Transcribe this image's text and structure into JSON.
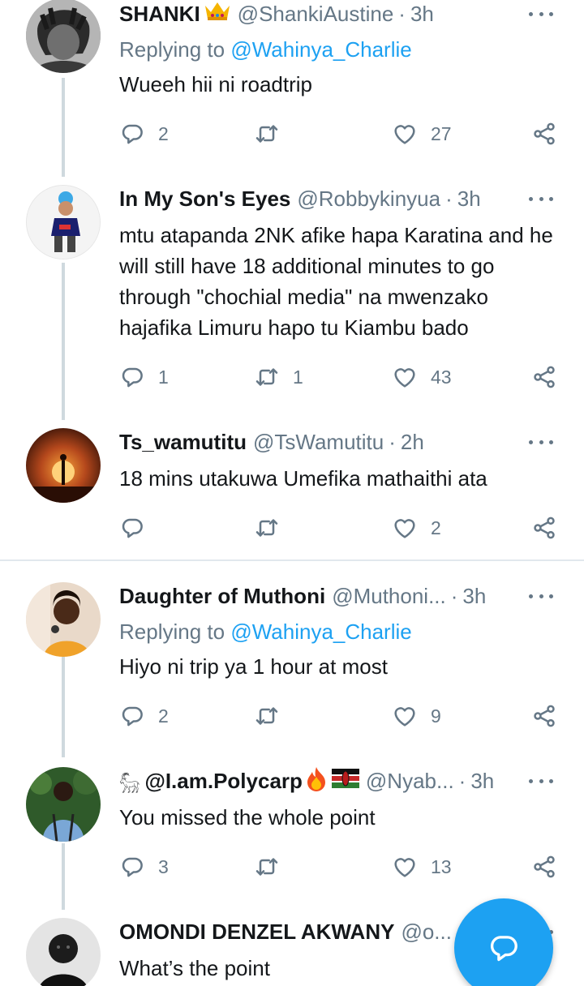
{
  "tweets": [
    {
      "name": "SHANKI",
      "handle": "@ShankiAustine",
      "time": "3h",
      "replying_label": "Replying to",
      "replying_to": "@Wahinya_Charlie",
      "text": "Wueeh hii ni roadtrip",
      "replies": "2",
      "retweets": "",
      "likes": "27"
    },
    {
      "name": "In My Son's Eyes",
      "handle": "@Robbykinyua",
      "time": "3h",
      "text": "mtu atapanda 2NK afike hapa Karatina and he will still have 18 additional minutes to go through \"chochial media\" na mwenzako hajafika Limuru hapo tu Kiambu bado",
      "replies": "1",
      "retweets": "1",
      "likes": "43"
    },
    {
      "name": "Ts_wamutitu",
      "handle": "@TsWamutitu",
      "time": "2h",
      "text": "18 mins utakuwa Umefika mathaithi ata",
      "replies": "",
      "retweets": "",
      "likes": "2"
    },
    {
      "name": "Daughter of Muthoni",
      "handle": "@Muthoni...",
      "time": "3h",
      "replying_label": "Replying to",
      "replying_to": "@Wahinya_Charlie",
      "text": "Hiyo ni trip ya 1 hour at most",
      "replies": "2",
      "retweets": "",
      "likes": "9"
    },
    {
      "name_prefix": "𓃵",
      "name": "@I.am.Polycarp",
      "handle": "@Nyab...",
      "time": "3h",
      "text": "You missed the whole point",
      "replies": "3",
      "retweets": "",
      "likes": "13"
    },
    {
      "name": "OMONDI DENZEL AKWANY",
      "handle": "@o...",
      "time": "",
      "text": "What’s the point"
    }
  ],
  "dot_separator": "·",
  "icons": {
    "reply": "reply-bubble-icon",
    "retweet": "retweet-icon",
    "like": "heart-icon",
    "share": "share-icon",
    "more": "more-dots-icon",
    "crown": "crown-emoji",
    "fire": "fire-emoji",
    "flag": "kenya-flag-emoji",
    "compose": "compose-reply-icon"
  },
  "colors": {
    "accent": "#1da1f2",
    "secondary_text": "#657786",
    "thread_line": "#cfd9de"
  }
}
